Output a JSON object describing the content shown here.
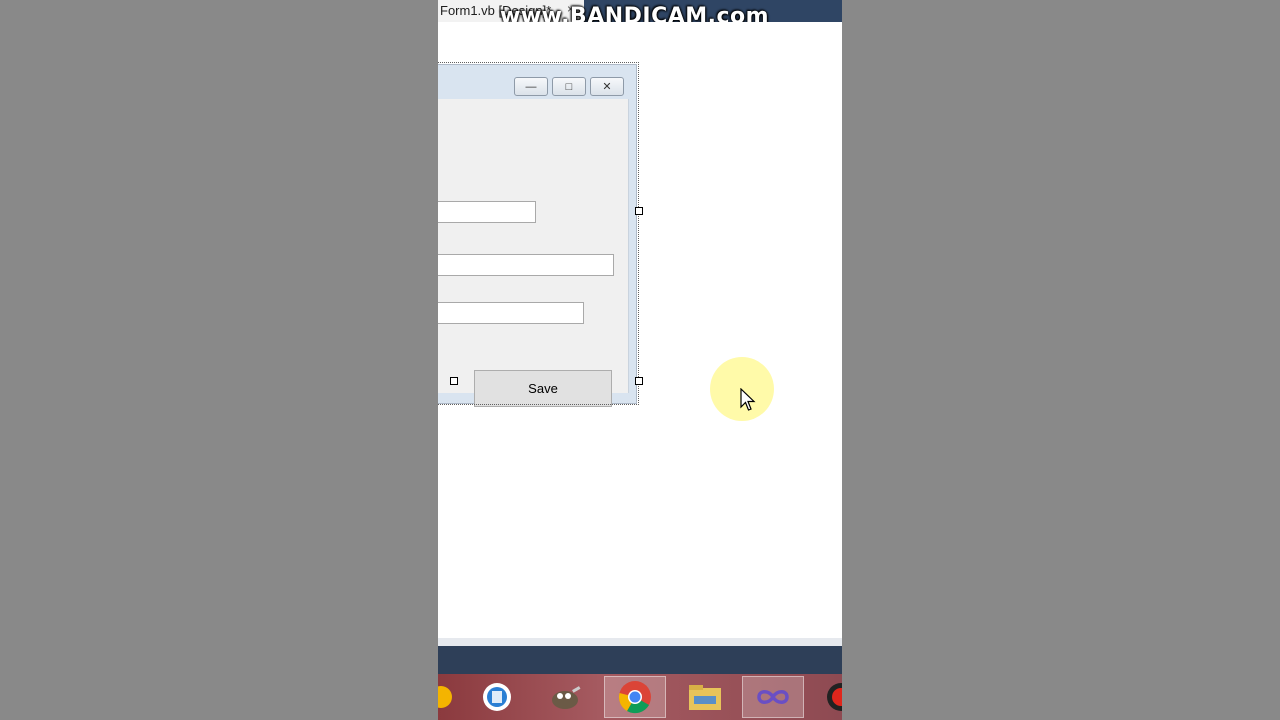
{
  "document_tab": {
    "title": "Form1.vb [Design]*",
    "close_glyph": "×"
  },
  "watermark": "www.BANDICAM.com",
  "form": {
    "caption_buttons": {
      "minimize": "—",
      "maximize": "□",
      "close": "✕"
    },
    "save_button_label": "Save"
  },
  "taskbar": {
    "items": [
      "chrome-app-icon",
      "ai-app-icon",
      "gimp-icon",
      "chrome-icon",
      "file-explorer-icon",
      "visual-studio-icon",
      "record-icon"
    ]
  },
  "colors": {
    "titlebar_dark": "#2f4564",
    "taskbar": "#9a4a50",
    "cursor_halo": "#fff6a0"
  }
}
